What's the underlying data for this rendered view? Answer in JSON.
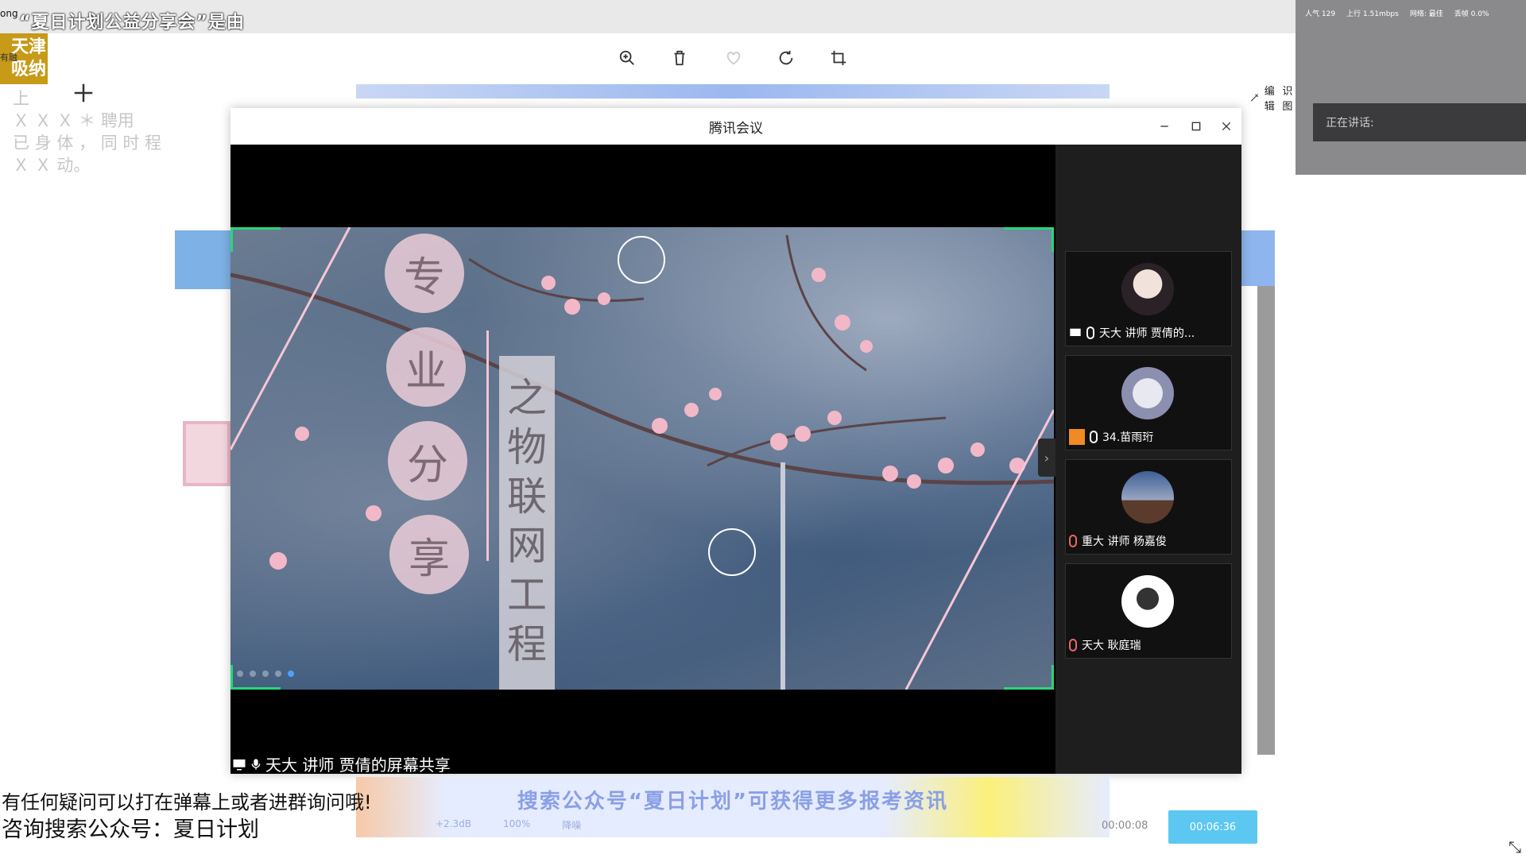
{
  "viewer": {
    "edit_label": "编辑",
    "edit_label_2": "识图",
    "tools": [
      "zoom-in-icon",
      "delete-icon",
      "favorite-icon",
      "rotate-icon",
      "crop-icon"
    ]
  },
  "banner": {
    "prefix": "ong",
    "headline": "“夏日计划公益分享会”是由",
    "gold_line1": "天津",
    "gold_line2": "吸纳",
    "small": "有融",
    "faded_lines": [
      "上",
      "Ｘ  Ｘ   Ｘ  ＊ 聘用",
      "已  身  体  ，  同  时  程",
      "Ｘ  Ｘ        动。"
    ],
    "faded_end": "动。"
  },
  "stream": {
    "stats": [
      "人气 129",
      "上行 1.51mbps",
      "网络: 最佳",
      "丢帧 0.0%"
    ],
    "speaking_label": "正在讲话:"
  },
  "meeting": {
    "title": "腾讯会议",
    "share_caption": "天大 讲师 贾倩的屏幕共享",
    "slide": {
      "circle_chars": [
        "专",
        "业",
        "分",
        "享"
      ],
      "vertical_chars": [
        "之",
        "物",
        "联",
        "网",
        "工",
        "程"
      ]
    },
    "participants": [
      {
        "name": "天大 讲师 贾倩的...",
        "mic": "on",
        "badge": "share"
      },
      {
        "name": "34.苗雨珩",
        "mic": "on",
        "badge": "host"
      },
      {
        "name": "重大 讲师 杨嘉俊",
        "mic": "off",
        "badge": ""
      },
      {
        "name": "天大 耿庭瑞",
        "mic": "off",
        "badge": ""
      }
    ]
  },
  "bottom": {
    "promo": "搜索公众号“夏日计划”可获得更多报考资讯",
    "controls": [
      "+2.3dB",
      "100%",
      "降噪"
    ],
    "timer_elapsed": "00:00:08",
    "timer_total": "00:06:36",
    "subtitle_1": "有任何疑问可以打在弹幕上或者进群询问哦!",
    "subtitle_2": "咨询搜索公众号：夏日计划"
  }
}
